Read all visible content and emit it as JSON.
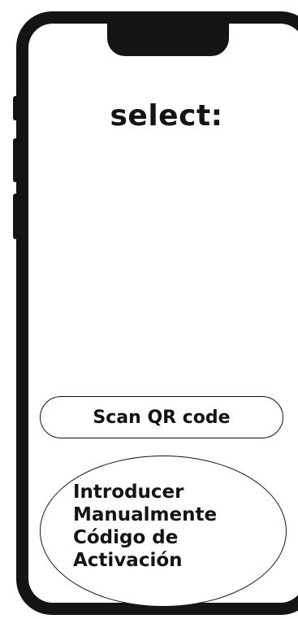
{
  "screen": {
    "title": "select:"
  },
  "options": {
    "scan_label": "Scan QR code",
    "manual_lines": [
      "Introducer",
      "Manualmente",
      "Código de",
      "Activación"
    ]
  },
  "colors": {
    "frame": "#141414",
    "background": "#ffffff"
  }
}
